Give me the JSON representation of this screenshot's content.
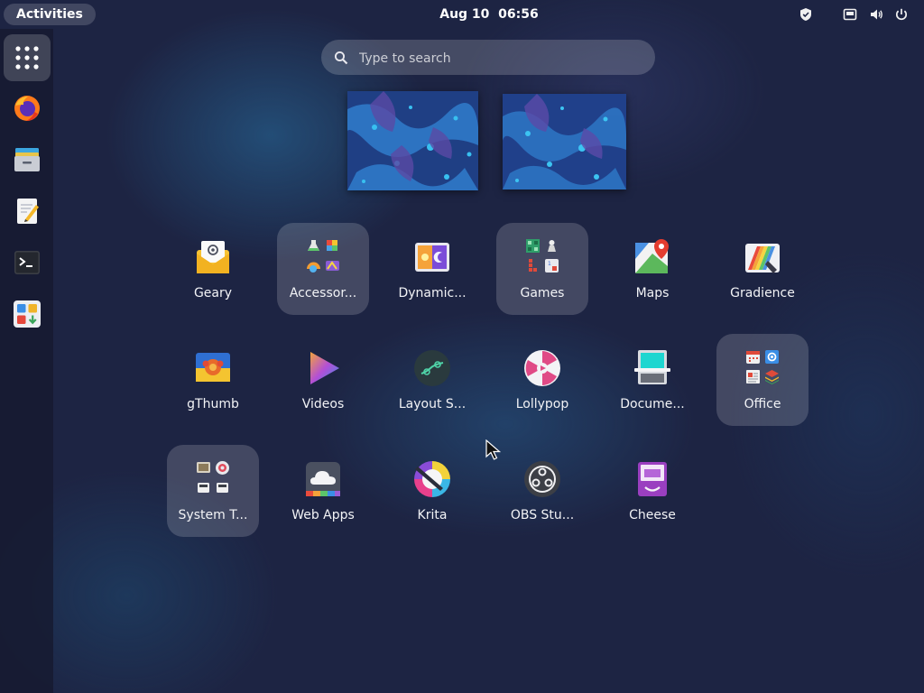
{
  "topbar": {
    "activities": "Activities",
    "date": "Aug 10",
    "time": "06:56",
    "tray_icons": [
      "shield-icon",
      "network-icon",
      "volume-icon",
      "power-icon"
    ]
  },
  "dash": {
    "items": [
      {
        "name": "show-apps-icon",
        "active": true
      },
      {
        "name": "firefox-icon"
      },
      {
        "name": "files-icon"
      },
      {
        "name": "text-editor-icon"
      },
      {
        "name": "terminal-icon"
      },
      {
        "name": "software-icon"
      }
    ]
  },
  "search": {
    "placeholder": "Type to search",
    "value": ""
  },
  "workspaces": [
    "workspace-1",
    "workspace-2"
  ],
  "apps": [
    {
      "label": "Geary",
      "icon": "geary-icon",
      "folder": false
    },
    {
      "label": "Accessor...",
      "icon": "accessories-folder-icon",
      "folder": true
    },
    {
      "label": "Dynamic...",
      "icon": "dynamic-wallpaper-icon",
      "folder": false
    },
    {
      "label": "Games",
      "icon": "games-folder-icon",
      "folder": true
    },
    {
      "label": "Maps",
      "icon": "maps-icon",
      "folder": false
    },
    {
      "label": "Gradience",
      "icon": "gradience-icon",
      "folder": false
    },
    {
      "label": "gThumb",
      "icon": "gthumb-icon",
      "folder": false
    },
    {
      "label": "Videos",
      "icon": "videos-icon",
      "folder": false
    },
    {
      "label": "Layout S...",
      "icon": "layout-switcher-icon",
      "folder": false
    },
    {
      "label": "Lollypop",
      "icon": "lollypop-icon",
      "folder": false
    },
    {
      "label": "Docume...",
      "icon": "document-scanner-icon",
      "folder": false
    },
    {
      "label": "Office",
      "icon": "office-folder-icon",
      "folder": true
    },
    {
      "label": "System T...",
      "icon": "system-tools-folder-icon",
      "folder": true
    },
    {
      "label": "Web Apps",
      "icon": "web-apps-icon",
      "folder": false
    },
    {
      "label": "Krita",
      "icon": "krita-icon",
      "folder": false
    },
    {
      "label": "OBS Stu...",
      "icon": "obs-studio-icon",
      "folder": false
    },
    {
      "label": "Cheese",
      "icon": "cheese-icon",
      "folder": false
    }
  ]
}
